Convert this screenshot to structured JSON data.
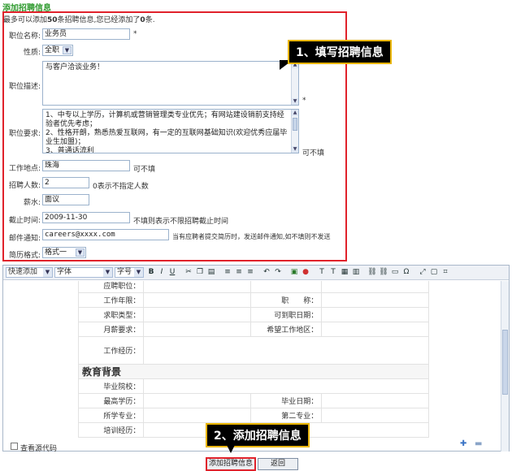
{
  "page": {
    "section_title": "添加招聘信息",
    "limit_note_prefix": "最多可以添加",
    "limit_count": "50",
    "limit_note_mid": "条招聘信息,您已经添加了",
    "added_count": "0",
    "limit_note_suffix": "条."
  },
  "form": {
    "position_name": {
      "label": "职位名称:",
      "value": "业务员",
      "required_mark": "*"
    },
    "job_type": {
      "label": "性质:",
      "value": "全职"
    },
    "description": {
      "label": "职位描述:",
      "value": "与客户洽谈业务！",
      "required_mark": "*"
    },
    "requirements": {
      "label": "职位要求:",
      "value": "1、中专以上学历，计算机或营销管理类专业优先；有网站建设销前支持经验者优先考虑；\n2、性格开朗，熟悉热爱互联网，有一定的互联网基础知识(欢迎优秀应届毕业生加盟)；\n3、普通话流利",
      "hint": "可不填"
    },
    "location": {
      "label": "工作地点:",
      "value": "珠海",
      "hint": "可不填"
    },
    "headcount": {
      "label": "招聘人数:",
      "value": "2",
      "hint": "0表示不指定人数"
    },
    "salary": {
      "label": "薪水:",
      "value": "面议"
    },
    "deadline": {
      "label": "截止时间:",
      "value": "2009-11-30",
      "hint": "不填则表示不限招聘截止时间"
    },
    "email": {
      "label": "邮件通知:",
      "value": "careers@xxxx.com",
      "hint": "当有应聘者提交简历时，发送邮件通知,如不填则不发送"
    },
    "resume_format": {
      "label": "简历格式:",
      "value": "格式一"
    }
  },
  "callouts": {
    "step1": "1、填写招聘信息",
    "step2": "2、添加招聘信息"
  },
  "editor": {
    "style_select": "快速添加",
    "font_select": "字体",
    "size_select": "字号",
    "bold": "B",
    "italic": "I",
    "underline": "U",
    "cut_row_label": "应聘职位：",
    "resume_rows": [
      {
        "k1": "工作年限：",
        "k2": "职　　称："
      },
      {
        "k1": "求职类型：",
        "k2": "可到职日期："
      },
      {
        "k1": "月薪要求：",
        "k2": "希望工作地区："
      }
    ],
    "experience_label": "工作经历：",
    "education_title": "教育背景",
    "edu_rows": [
      {
        "k1": "毕业院校：",
        "k2": ""
      },
      {
        "k1": "最高学历：",
        "k2": "毕业日期："
      },
      {
        "k1": "所学专业：",
        "k2": "第二专业："
      },
      {
        "k1": "培训经历：",
        "k2": ""
      }
    ]
  },
  "footer": {
    "view_source_label": "查看源代码",
    "submit_label": "添加招聘信息",
    "back_label": "返回"
  }
}
